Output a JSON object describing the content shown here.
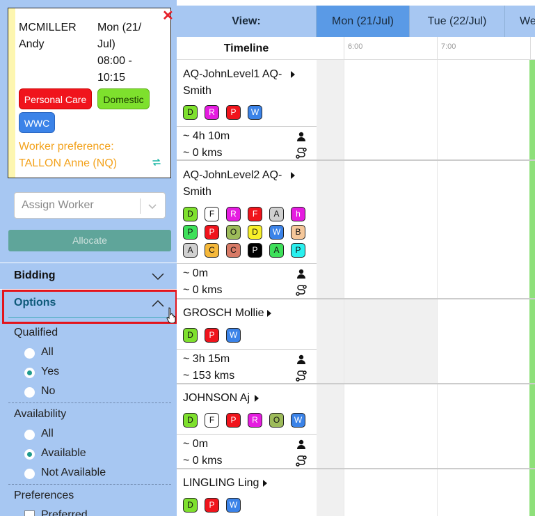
{
  "job": {
    "client_last": "MCMILLER",
    "client_first": "Andy",
    "date_line1": "Mon (21/",
    "date_line2": "Jul)",
    "time_line1": "08:00 -",
    "time_line2": "10:15",
    "close_symbol": "✕",
    "tags": [
      {
        "label": "Personal Care",
        "color": "#f0141c",
        "text_color": "#ffffff"
      },
      {
        "label": "Domestic",
        "color": "#7ee02d",
        "text_color": "#1a3a00"
      },
      {
        "label": "WWC",
        "color": "#3b83e8",
        "text_color": "#ffffff"
      }
    ],
    "pref_line1": "Worker preference:",
    "pref_line2": "TALLON Anne (NQ)",
    "swap_icon": "swap-icon"
  },
  "assign": {
    "placeholder": "Assign Worker"
  },
  "allocate_label": "Allocate",
  "sections": {
    "bidding": "Bidding",
    "options": "Options"
  },
  "filters": {
    "qualified": {
      "label": "Qualified",
      "options": [
        "All",
        "Yes",
        "No"
      ],
      "selected": "Yes"
    },
    "availability": {
      "label": "Availability",
      "options": [
        "All",
        "Available",
        "Not Available"
      ],
      "selected": "Available"
    },
    "preferences": {
      "label": "Preferences",
      "options": [
        "Preferred"
      ]
    }
  },
  "topbar": {
    "view_label": "View:",
    "days": [
      "Mon (21/Jul)",
      "Tue (22/Jul)",
      "We"
    ],
    "active_day": "Mon (21/Jul)"
  },
  "timeline": {
    "label": "Timeline",
    "ticks": [
      "6:00",
      "7:00"
    ]
  },
  "colors": {
    "accent": "#5a9ae6",
    "panel": "#a7c7f2",
    "highlight": "#e3141c",
    "available_bar": "#8ee07a"
  },
  "workers": [
    {
      "name_line1": "AQ-JohnLevel1 AQ-",
      "name_line2": "Smith",
      "skills": [
        {
          "c": "D",
          "bg": "#7ee02d",
          "fg": "#111"
        },
        {
          "c": "R",
          "bg": "#e51ce0",
          "fg": "#fff"
        },
        {
          "c": "P",
          "bg": "#f0141c",
          "fg": "#fff"
        },
        {
          "c": "W",
          "bg": "#3b83e8",
          "fg": "#fff"
        }
      ],
      "duration": "~ 4h 10m",
      "distance": "~ 0 kms"
    },
    {
      "name_line1": "AQ-JohnLevel2 AQ-",
      "name_line2": "Smith",
      "skills": [
        {
          "c": "D",
          "bg": "#7ee02d",
          "fg": "#111"
        },
        {
          "c": "F",
          "bg": "#ffffff",
          "fg": "#111"
        },
        {
          "c": "R",
          "bg": "#e51ce0",
          "fg": "#fff"
        },
        {
          "c": "F",
          "bg": "#f0141c",
          "fg": "#fff"
        },
        {
          "c": "A",
          "bg": "#d0d0d0",
          "fg": "#111"
        },
        {
          "c": "h",
          "bg": "#e51ce0",
          "fg": "#fff"
        },
        {
          "c": "P",
          "bg": "#3ee05a",
          "fg": "#111"
        },
        {
          "c": "P",
          "bg": "#f0141c",
          "fg": "#fff"
        },
        {
          "c": "O",
          "bg": "#9dbb5a",
          "fg": "#111"
        },
        {
          "c": "D",
          "bg": "#f8f02a",
          "fg": "#111"
        },
        {
          "c": "W",
          "bg": "#3b83e8",
          "fg": "#fff"
        },
        {
          "c": "B",
          "bg": "#f5c79a",
          "fg": "#111"
        },
        {
          "c": "A",
          "bg": "#d0d0d0",
          "fg": "#111"
        },
        {
          "c": "C",
          "bg": "#f5b83a",
          "fg": "#111"
        },
        {
          "c": "C",
          "bg": "#d87a66",
          "fg": "#111"
        },
        {
          "c": "P",
          "bg": "#000000",
          "fg": "#fff"
        },
        {
          "c": "A",
          "bg": "#3ee05a",
          "fg": "#111"
        },
        {
          "c": "P",
          "bg": "#2af0ef",
          "fg": "#111"
        }
      ],
      "duration": "~ 0m",
      "distance": "~ 0 kms"
    },
    {
      "name_line1": "GROSCH Mollie",
      "name_line2": "",
      "skills": [
        {
          "c": "D",
          "bg": "#7ee02d",
          "fg": "#111"
        },
        {
          "c": "P",
          "bg": "#f0141c",
          "fg": "#fff"
        },
        {
          "c": "W",
          "bg": "#3b83e8",
          "fg": "#fff"
        }
      ],
      "duration": "~ 3h 15m",
      "distance": "~ 153 kms"
    },
    {
      "name_line1": "JOHNSON Aj",
      "name_line2": "",
      "skills": [
        {
          "c": "D",
          "bg": "#7ee02d",
          "fg": "#111"
        },
        {
          "c": "F",
          "bg": "#ffffff",
          "fg": "#111"
        },
        {
          "c": "P",
          "bg": "#f0141c",
          "fg": "#fff"
        },
        {
          "c": "R",
          "bg": "#e51ce0",
          "fg": "#fff"
        },
        {
          "c": "O",
          "bg": "#9dbb5a",
          "fg": "#111"
        },
        {
          "c": "W",
          "bg": "#3b83e8",
          "fg": "#fff"
        }
      ],
      "duration": "~ 0m",
      "distance": "~ 0 kms"
    },
    {
      "name_line1": "LINGLING Ling",
      "name_line2": "",
      "skills": [
        {
          "c": "D",
          "bg": "#7ee02d",
          "fg": "#111"
        },
        {
          "c": "P",
          "bg": "#f0141c",
          "fg": "#fff"
        },
        {
          "c": "W",
          "bg": "#3b83e8",
          "fg": "#fff"
        }
      ],
      "duration": "",
      "distance": ""
    }
  ]
}
